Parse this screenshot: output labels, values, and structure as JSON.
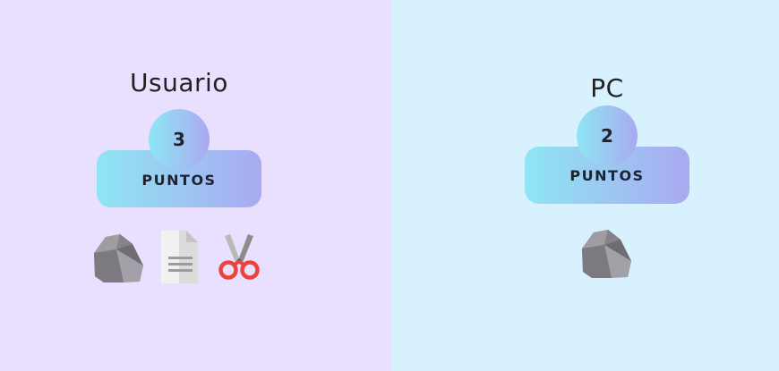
{
  "user": {
    "name": "Usuario",
    "score": "3",
    "points_label": "PUNTOS",
    "choices": [
      {
        "id": "rock",
        "icon": "rock-icon"
      },
      {
        "id": "paper",
        "icon": "paper-icon"
      },
      {
        "id": "scissors",
        "icon": "scissors-icon"
      }
    ]
  },
  "pc": {
    "name": "PC",
    "score": "2",
    "points_label": "PUNTOS",
    "choice": {
      "id": "rock",
      "icon": "rock-icon"
    }
  },
  "colors": {
    "user_panel_bg": "#e8e0fe",
    "pc_panel_bg": "#d8f1ff",
    "gradient_start": "#8ee6f3",
    "gradient_end": "#aaa9f1"
  }
}
